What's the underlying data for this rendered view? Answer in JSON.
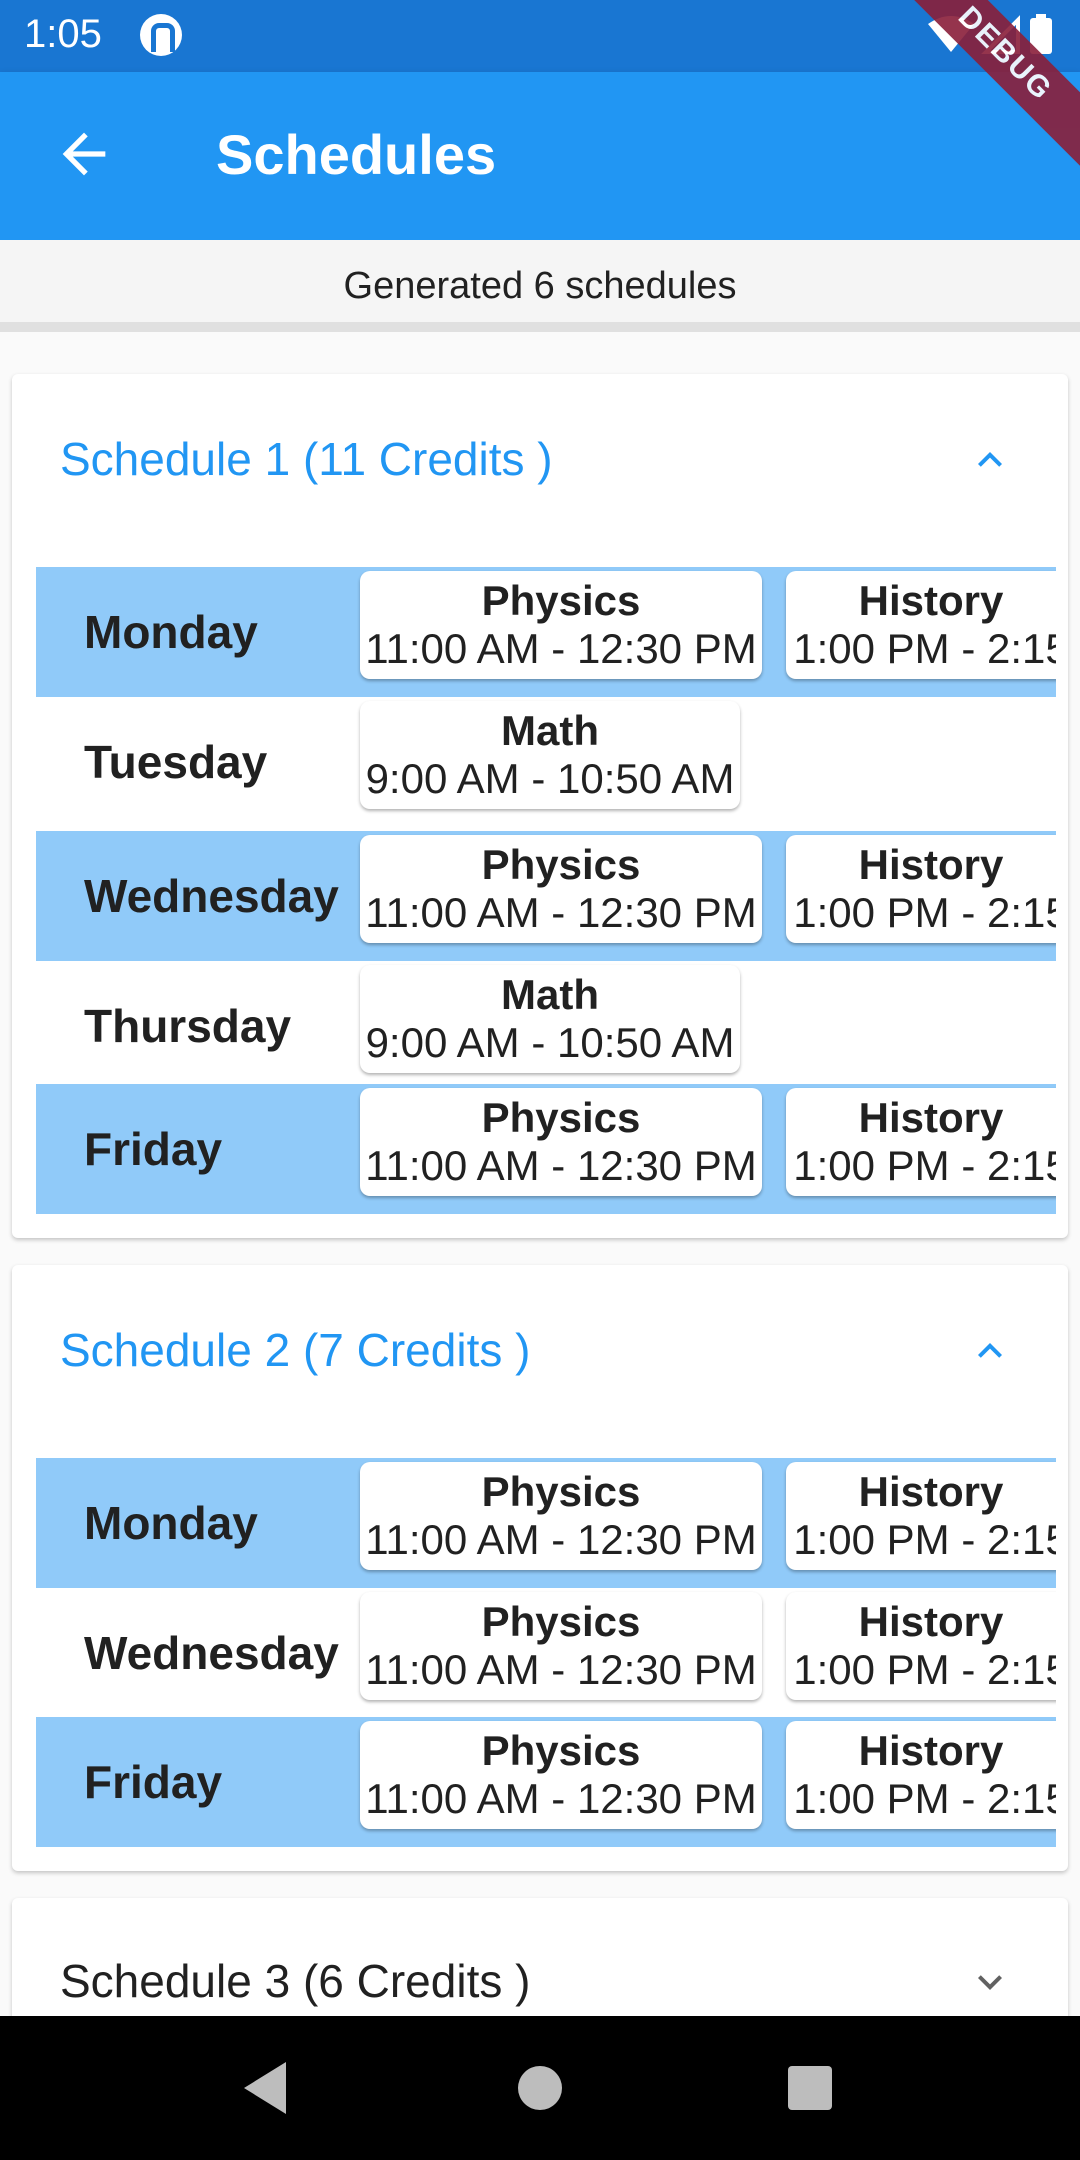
{
  "status": {
    "time": "1:05"
  },
  "app_bar": {
    "title": "Schedules",
    "debug": "DEBUG"
  },
  "summary": "Generated 6 schedules",
  "schedules": [
    {
      "title": "Schedule 1 (11 Credits )",
      "expanded": true,
      "days": [
        {
          "day": "Monday",
          "classes": [
            {
              "name": "Physics",
              "time": "11:00 AM - 12:30 PM"
            },
            {
              "name": "History",
              "time": "1:00 PM - 2:15"
            }
          ]
        },
        {
          "day": "Tuesday",
          "classes": [
            {
              "name": "Math",
              "time": "9:00 AM - 10:50 AM"
            }
          ]
        },
        {
          "day": "Wednesday",
          "classes": [
            {
              "name": "Physics",
              "time": "11:00 AM - 12:30 PM"
            },
            {
              "name": "History",
              "time": "1:00 PM - 2:15"
            }
          ]
        },
        {
          "day": "Thursday",
          "classes": [
            {
              "name": "Math",
              "time": "9:00 AM - 10:50 AM"
            }
          ]
        },
        {
          "day": "Friday",
          "classes": [
            {
              "name": "Physics",
              "time": "11:00 AM - 12:30 PM"
            },
            {
              "name": "History",
              "time": "1:00 PM - 2:15"
            }
          ]
        }
      ]
    },
    {
      "title": "Schedule 2 (7 Credits )",
      "expanded": true,
      "days": [
        {
          "day": "Monday",
          "classes": [
            {
              "name": "Physics",
              "time": "11:00 AM - 12:30 PM"
            },
            {
              "name": "History",
              "time": "1:00 PM - 2:15"
            }
          ]
        },
        {
          "day": "Wednesday",
          "classes": [
            {
              "name": "Physics",
              "time": "11:00 AM - 12:30 PM"
            },
            {
              "name": "History",
              "time": "1:00 PM - 2:15"
            }
          ]
        },
        {
          "day": "Friday",
          "classes": [
            {
              "name": "Physics",
              "time": "11:00 AM - 12:30 PM"
            },
            {
              "name": "History",
              "time": "1:00 PM - 2:15"
            }
          ]
        }
      ]
    },
    {
      "title": "Schedule 3 (6 Credits )",
      "expanded": false,
      "days": []
    }
  ],
  "colors": {
    "primary": "#2196f3",
    "status_bar": "#1976d2",
    "row_highlight": "#90caf9",
    "debug_banner": "#8a1f3a"
  }
}
